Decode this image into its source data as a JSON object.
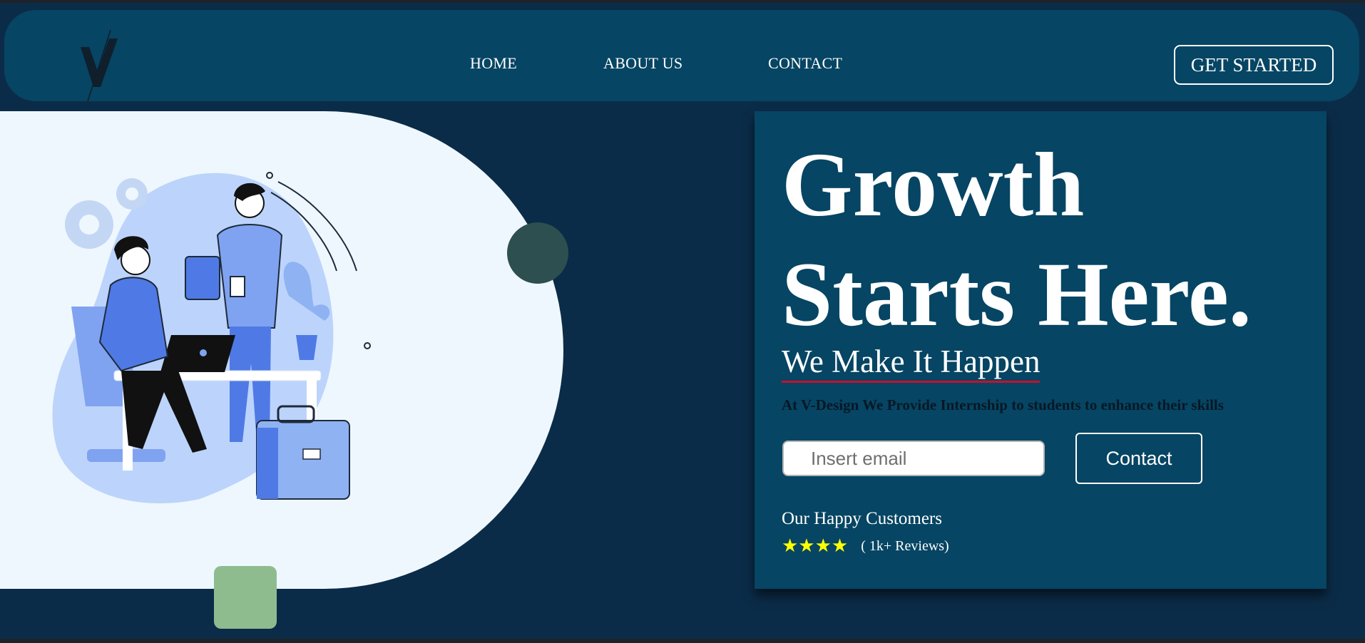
{
  "nav": {
    "links": [
      "HOME",
      "ABOUT US",
      "CONTACT"
    ],
    "cta_label": "GET STARTED"
  },
  "hero": {
    "headline": "Growth Starts Here.",
    "subheading": "We Make It Happen",
    "tagline": "At V-Design We Provide Internship to students to enhance their skills",
    "email_placeholder": "Insert email",
    "contact_label": "Contact",
    "customers_title": "Our Happy Customers",
    "stars": "★★★★",
    "reviews": "( 1k+ Reviews)"
  },
  "colors": {
    "page_background": "#0b2c48",
    "navbar": "#064563",
    "card": "#064563",
    "blob": "#eef7fe",
    "accent_underline": "#c8102e",
    "star": "#ffff00",
    "deco_circle": "#2e4f4f",
    "deco_square": "#8fbc8f"
  }
}
